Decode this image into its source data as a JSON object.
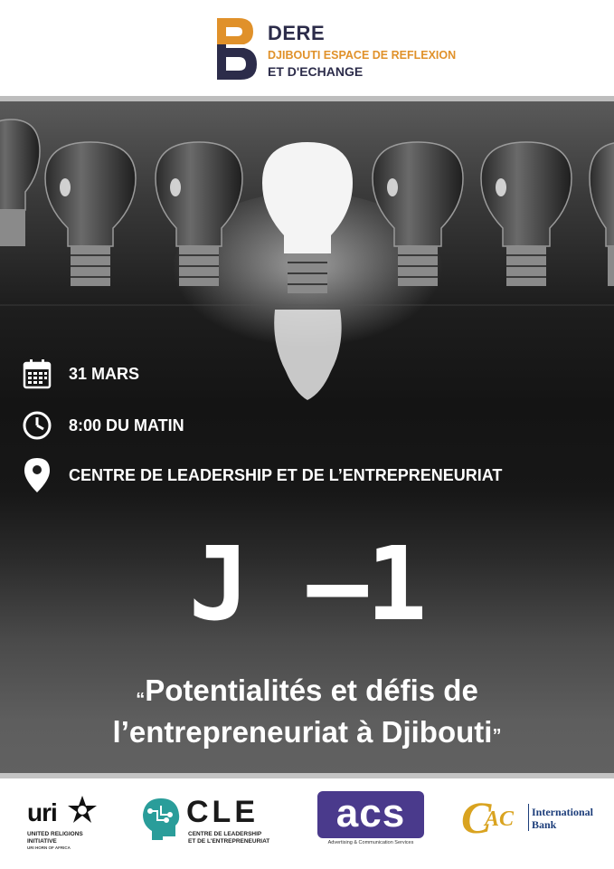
{
  "header": {
    "brand_name": "DERE",
    "brand_sub1": "DJIBOUTI ESPACE DE REFLEXION",
    "brand_sub2": "ET D'ECHANGE",
    "colors": {
      "navy": "#2c2c4a",
      "orange": "#e0912a"
    }
  },
  "event": {
    "date": "31 MARS",
    "time": "8:00 DU MATIN",
    "location": "CENTRE DE LEADERSHIP ET DE L’ENTREPRENEURIAT",
    "countdown": "J –1",
    "quote_open": "“",
    "quote_line1": "Potentialités et défis de",
    "quote_line2": "l’entrepreneuriat à Djibouti",
    "quote_close": "”",
    "icons": [
      "calendar-icon",
      "clock-icon",
      "location-pin-icon"
    ]
  },
  "footer": {
    "uri": {
      "word": "uri",
      "line1": "UNITED RELIGIONS",
      "line2": "INITIATIVE",
      "line3": "URI HORN OF AFRICA"
    },
    "cle": {
      "word": "CLE",
      "line1": "CENTRE DE LEADERSHIP",
      "line2": "ET DE L'ENTREPRENEURIAT"
    },
    "acs": {
      "word": "acs",
      "tagline": "Advertising & Communication Services",
      "color": "#4a3a8c"
    },
    "cac": {
      "mark_c": "C",
      "mark_ac": "AC",
      "line1": "International",
      "line2": "Bank",
      "gold": "#d9a320",
      "blue": "#1c3d7a"
    }
  }
}
